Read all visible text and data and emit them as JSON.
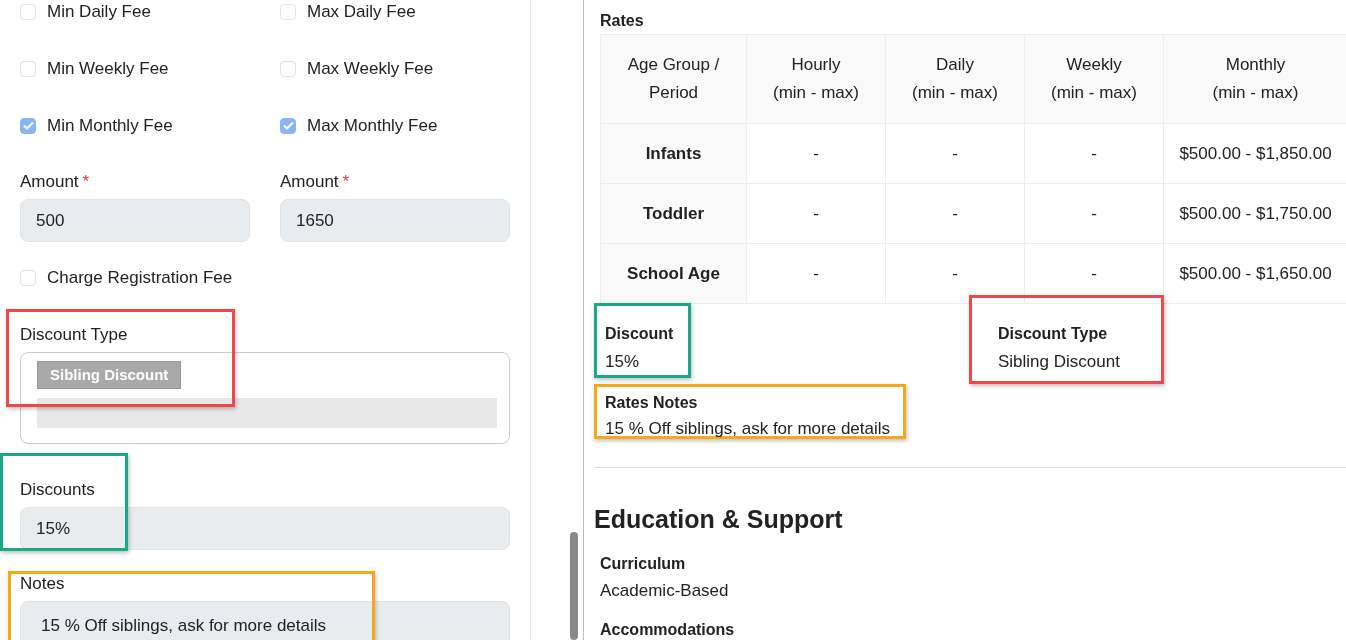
{
  "form": {
    "fee_options": [
      {
        "label": "Min Daily Fee",
        "checked": false
      },
      {
        "label": "Max Daily Fee",
        "checked": false
      },
      {
        "label": "Min Weekly Fee",
        "checked": false
      },
      {
        "label": "Max Weekly Fee",
        "checked": false
      },
      {
        "label": "Min Monthly Fee",
        "checked": true
      },
      {
        "label": "Max Monthly Fee",
        "checked": true
      }
    ],
    "amounts": [
      {
        "label": "Amount",
        "required_mark": "*",
        "value": "500"
      },
      {
        "label": "Amount",
        "required_mark": "*",
        "value": "1650"
      }
    ],
    "charge_registration_fee": {
      "label": "Charge Registration Fee",
      "checked": false
    },
    "discount_type": {
      "label": "Discount Type",
      "tags": [
        "Sibling Discount"
      ],
      "color": "#f04848"
    },
    "discounts": {
      "label": "Discounts",
      "value": "15%",
      "color": "#1aa88a"
    },
    "notes": {
      "label": "Notes",
      "value": "15 % Off siblings, ask for more details",
      "color": "#f5a818"
    }
  },
  "details": {
    "rates": {
      "title": "Rates",
      "columns": [
        "Age Group /\nPeriod",
        "Hourly\n(min - max)",
        "Daily\n(min - max)",
        "Weekly\n(min - max)",
        "Monthly\n(min - max)"
      ],
      "rows": [
        [
          "Infants",
          "-",
          "-",
          "-",
          "$500.00 - $1,850.00"
        ],
        [
          "Toddler",
          "-",
          "-",
          "-",
          "$500.00 - $1,750.00"
        ],
        [
          "School Age",
          "-",
          "-",
          "-",
          "$500.00 - $1,650.00"
        ]
      ]
    },
    "discount": {
      "label": "Discount",
      "value": "15%",
      "color": "#1aa88a"
    },
    "discount_type": {
      "label": "Discount Type",
      "value": "Sibling Discount",
      "color": "#f04848"
    },
    "rates_notes": {
      "label": "Rates Notes",
      "value": "15 % Off siblings, ask for more details",
      "color": "#f5a818"
    },
    "section_title": "Education & Support",
    "items": [
      {
        "label": "Curriculum",
        "value": "Academic-Based"
      },
      {
        "label": "Accommodations"
      }
    ]
  }
}
